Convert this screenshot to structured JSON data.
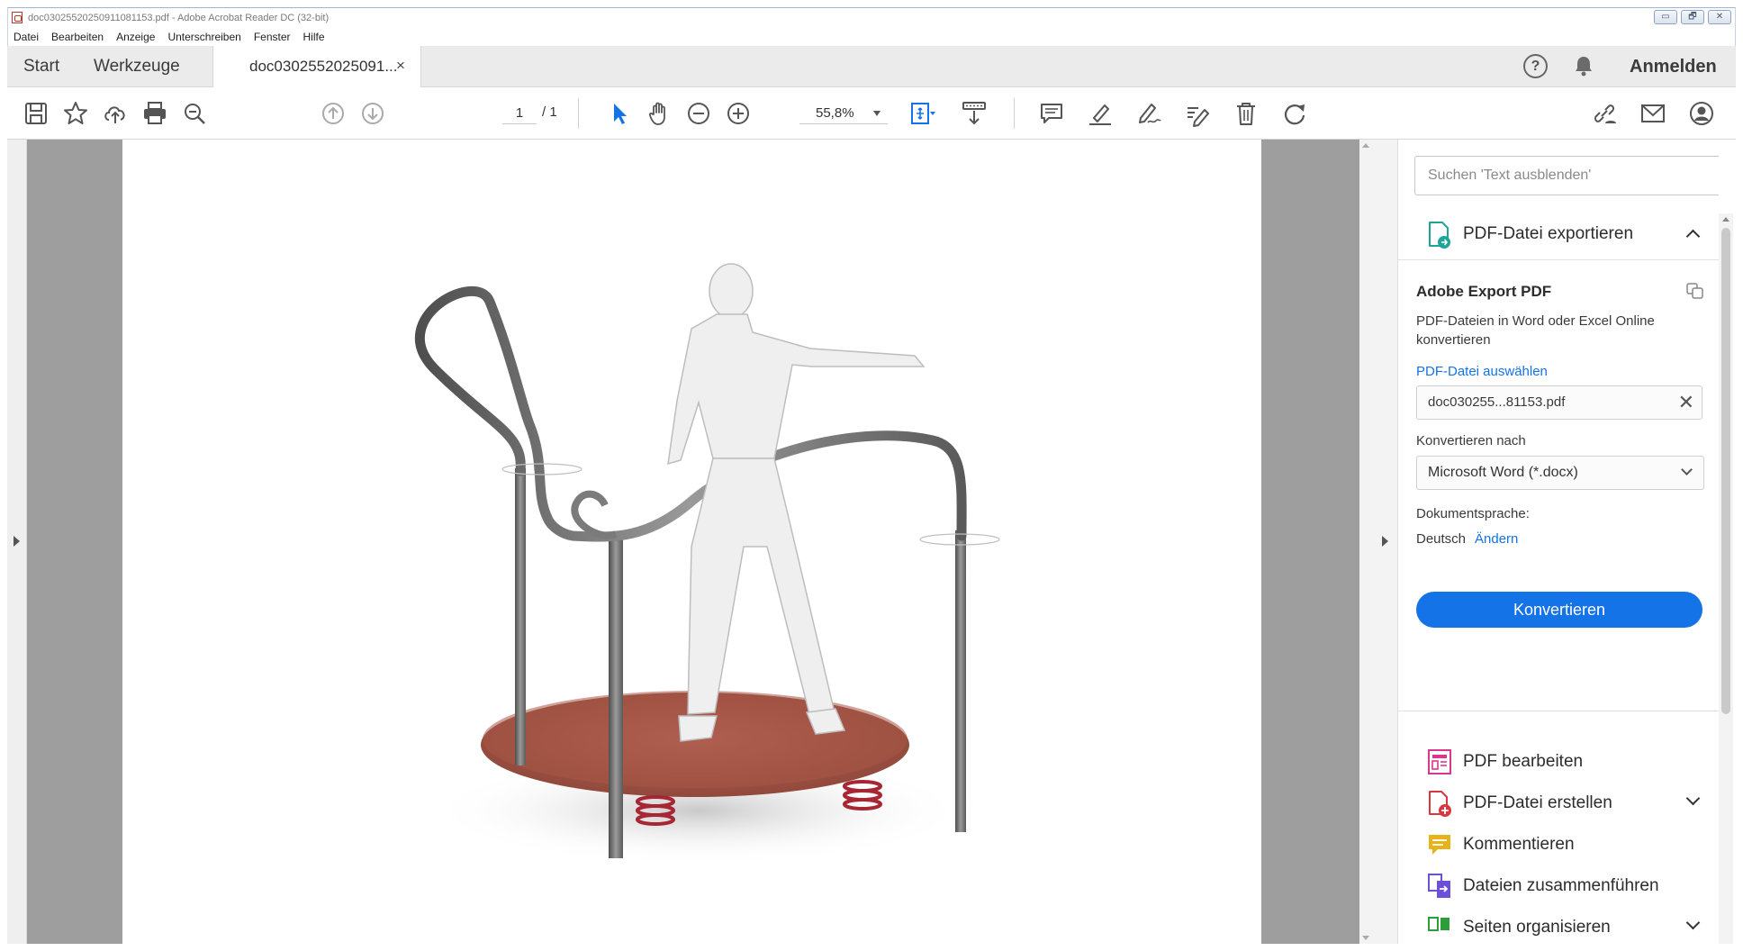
{
  "window": {
    "title": "doc03025520250911081153.pdf - Adobe Acrobat Reader DC (32-bit)",
    "controls": [
      "▭",
      "🗗",
      "✕"
    ]
  },
  "menu": [
    "Datei",
    "Bearbeiten",
    "Anzeige",
    "Unterschreiben",
    "Fenster",
    "Hilfe"
  ],
  "tabs": {
    "home": "Start",
    "tools": "Werkzeuge",
    "document": "doc0302552025091...",
    "close": "×"
  },
  "header": {
    "signin": "Anmelden",
    "help": "?"
  },
  "toolbar": {
    "page_current": "1",
    "page_total": "/ 1",
    "zoom": "55,8%",
    "icons": [
      "save-icon",
      "bookmark-star-icon",
      "cloud-upload-icon",
      "print-icon",
      "zoom-search-icon",
      "page-up-icon",
      "page-down-icon",
      "select-cursor-icon",
      "hand-icon",
      "zoom-out-icon",
      "zoom-in-icon",
      "fit-page-icon",
      "scroll-mode-icon",
      "comment-icon",
      "highlight-icon",
      "draw-icon",
      "edit-text-icon",
      "delete-icon",
      "rotate-icon",
      "share-link-icon",
      "email-icon",
      "account-icon"
    ]
  },
  "right_pane": {
    "search_placeholder": "Suchen 'Text ausblenden'",
    "export_section": "PDF-Datei exportieren",
    "export_title": "Adobe Export PDF",
    "export_desc": "PDF-Dateien in Word oder Excel Online konvertieren",
    "select_file": "PDF-Datei auswählen",
    "file_name": "doc030255...81153.pdf",
    "convert_to_label": "Konvertieren nach",
    "format": "Microsoft Word (*.docx)",
    "lang_label": "Dokumentsprache:",
    "lang_value": "Deutsch",
    "lang_change": "Ändern",
    "convert_button": "Konvertieren",
    "tools": [
      {
        "label": "PDF bearbeiten",
        "color": "#d83790"
      },
      {
        "label": "PDF-Datei erstellen",
        "color": "#d7373f"
      },
      {
        "label": "Kommentieren",
        "color": "#e8b31a"
      },
      {
        "label": "Dateien zusammenführen",
        "color": "#6e4fd8"
      },
      {
        "label": "Seiten organisieren",
        "color": "#2d9d3a"
      }
    ]
  },
  "colors": {
    "accent": "#1473e6",
    "export_icon": "#1fa49b"
  }
}
